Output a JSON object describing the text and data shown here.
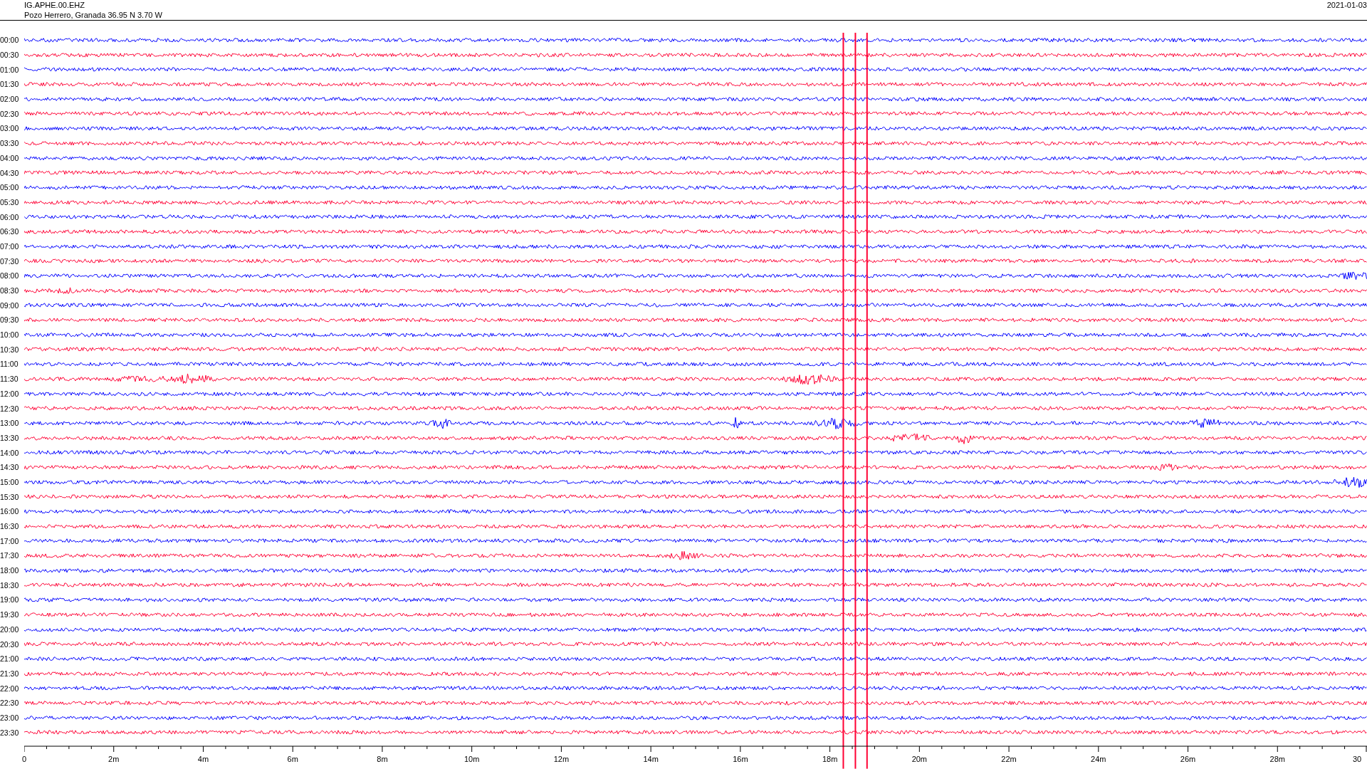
{
  "header": {
    "station": "IG.APHE.00.EHZ",
    "location": "Pozo Herrero, Granada  36.95 N 3.70 W",
    "date": "2021-01-03"
  },
  "rows": [
    {
      "time": "00:00",
      "color": "#0000ff"
    },
    {
      "time": "00:30",
      "color": "#ff0033"
    },
    {
      "time": "01:00",
      "color": "#0000ff"
    },
    {
      "time": "01:30",
      "color": "#ff0033"
    },
    {
      "time": "02:00",
      "color": "#0000ff"
    },
    {
      "time": "02:30",
      "color": "#ff0033"
    },
    {
      "time": "03:00",
      "color": "#0000ff"
    },
    {
      "time": "03:30",
      "color": "#ff0033"
    },
    {
      "time": "04:00",
      "color": "#0000ff"
    },
    {
      "time": "04:30",
      "color": "#ff0033"
    },
    {
      "time": "05:00",
      "color": "#0000ff"
    },
    {
      "time": "05:30",
      "color": "#ff0033"
    },
    {
      "time": "06:00",
      "color": "#0000ff"
    },
    {
      "time": "06:30",
      "color": "#ff0033"
    },
    {
      "time": "07:00",
      "color": "#0000ff"
    },
    {
      "time": "07:30",
      "color": "#ff0033"
    },
    {
      "time": "08:00",
      "color": "#0000ff"
    },
    {
      "time": "08:30",
      "color": "#ff0033"
    },
    {
      "time": "09:00",
      "color": "#0000ff"
    },
    {
      "time": "09:30",
      "color": "#ff0033"
    },
    {
      "time": "10:00",
      "color": "#0000ff"
    },
    {
      "time": "10:30",
      "color": "#ff0033"
    },
    {
      "time": "11:00",
      "color": "#0000ff"
    },
    {
      "time": "11:30",
      "color": "#ff0033"
    },
    {
      "time": "12:00",
      "color": "#0000ff"
    },
    {
      "time": "12:30",
      "color": "#ff0033"
    },
    {
      "time": "13:00",
      "color": "#0000ff"
    },
    {
      "time": "13:30",
      "color": "#ff0033"
    },
    {
      "time": "14:00",
      "color": "#0000ff"
    },
    {
      "time": "14:30",
      "color": "#ff0033"
    },
    {
      "time": "15:00",
      "color": "#0000ff"
    },
    {
      "time": "15:30",
      "color": "#ff0033"
    },
    {
      "time": "16:00",
      "color": "#0000ff"
    },
    {
      "time": "16:30",
      "color": "#ff0033"
    },
    {
      "time": "17:00",
      "color": "#0000ff"
    },
    {
      "time": "17:30",
      "color": "#ff0033"
    },
    {
      "time": "18:00",
      "color": "#0000ff"
    },
    {
      "time": "18:30",
      "color": "#ff0033"
    },
    {
      "time": "19:00",
      "color": "#0000ff"
    },
    {
      "time": "19:30",
      "color": "#ff0033"
    },
    {
      "time": "20:00",
      "color": "#0000ff"
    },
    {
      "time": "20:30",
      "color": "#ff0033"
    },
    {
      "time": "21:00",
      "color": "#0000ff"
    },
    {
      "time": "21:30",
      "color": "#ff0033"
    },
    {
      "time": "22:00",
      "color": "#0000ff"
    },
    {
      "time": "22:30",
      "color": "#ff0033"
    },
    {
      "time": "23:00",
      "color": "#0000ff"
    },
    {
      "time": "23:30",
      "color": "#ff0033"
    }
  ],
  "x_axis": {
    "ticks": [
      "0",
      "2m",
      "4m",
      "6m",
      "8m",
      "10m",
      "12m",
      "14m",
      "16m",
      "18m",
      "20m",
      "22m",
      "24m",
      "26m",
      "28m",
      "30"
    ]
  }
}
